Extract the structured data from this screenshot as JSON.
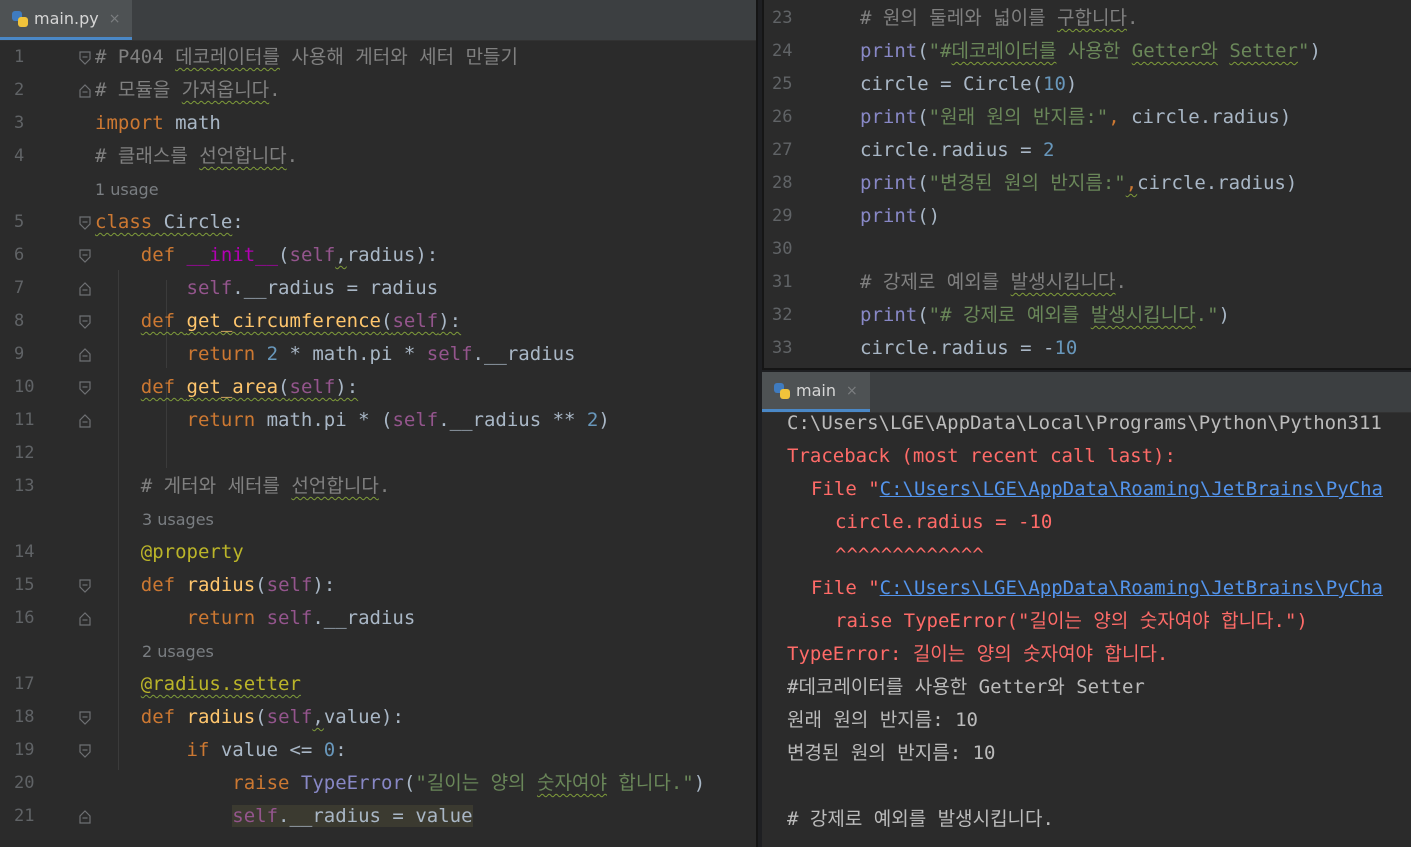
{
  "left_editor": {
    "tab": {
      "title": "main.py",
      "close": "×"
    },
    "lines": [
      {
        "num": "1",
        "parts": [
          [
            "cm",
            "# P404 "
          ],
          [
            "cm wv",
            "데코레이터를"
          ],
          [
            "cm",
            " 사용해 게터와 세터 만들기"
          ]
        ]
      },
      {
        "num": "2",
        "parts": [
          [
            "cm",
            "# 모듈을 "
          ],
          [
            "cm wv",
            "가져옵니다"
          ],
          [
            "cm",
            "."
          ]
        ]
      },
      {
        "num": "3",
        "parts": [
          [
            "kw",
            "import"
          ],
          [
            "",
            " math"
          ]
        ]
      },
      {
        "num": "4",
        "parts": [
          [
            "cm",
            "# 클래스를 "
          ],
          [
            "cm wv",
            "선언합니다"
          ],
          [
            "cm",
            "."
          ]
        ]
      },
      {
        "num": "5",
        "parts": [
          [
            "kw wv",
            "class"
          ],
          [
            "wv",
            " Circle"
          ],
          [
            "",
            ":"
          ]
        ]
      },
      {
        "num": "6",
        "parts": [
          [
            "",
            "    "
          ],
          [
            "kw",
            "def "
          ],
          [
            "mg",
            "__init__"
          ],
          [
            "",
            "("
          ],
          [
            "sf",
            "self"
          ],
          [
            "wv",
            ","
          ],
          [
            "",
            "radius):"
          ]
        ]
      },
      {
        "num": "7",
        "parts": [
          [
            "",
            "        "
          ],
          [
            "sf",
            "self"
          ],
          [
            "",
            ".__radius = radius"
          ]
        ]
      },
      {
        "num": "8",
        "parts": [
          [
            "",
            "    "
          ],
          [
            "kw wv",
            "def "
          ],
          [
            "fn wv",
            "get_circumference"
          ],
          [
            "wv",
            "("
          ],
          [
            "sf wv",
            "self"
          ],
          [
            "wv",
            "):"
          ]
        ]
      },
      {
        "num": "9",
        "parts": [
          [
            "",
            "        "
          ],
          [
            "kw",
            "return "
          ],
          [
            "nm",
            "2"
          ],
          [
            "",
            " * math.pi * "
          ],
          [
            "sf",
            "self"
          ],
          [
            "",
            ".__radius"
          ]
        ]
      },
      {
        "num": "10",
        "parts": [
          [
            "",
            "    "
          ],
          [
            "kw wv",
            "def "
          ],
          [
            "fn wv",
            "get_area"
          ],
          [
            "wv",
            "("
          ],
          [
            "sf wv",
            "self"
          ],
          [
            "wv",
            "):"
          ]
        ]
      },
      {
        "num": "11",
        "parts": [
          [
            "",
            "        "
          ],
          [
            "kw",
            "return"
          ],
          [
            "",
            " math.pi * ("
          ],
          [
            "sf",
            "self"
          ],
          [
            "",
            ".__radius ** "
          ],
          [
            "nm",
            "2"
          ],
          [
            "",
            ")"
          ]
        ]
      },
      {
        "num": "12",
        "parts": []
      },
      {
        "num": "13",
        "parts": [
          [
            "",
            "    "
          ],
          [
            "cm",
            "# 게터와 세터를 "
          ],
          [
            "cm wv",
            "선언합니다"
          ],
          [
            "cm",
            "."
          ]
        ]
      },
      {
        "num": "14",
        "parts": [
          [
            "",
            "    "
          ],
          [
            "dc",
            "@property"
          ]
        ]
      },
      {
        "num": "15",
        "parts": [
          [
            "",
            "    "
          ],
          [
            "kw",
            "def "
          ],
          [
            "fn",
            "radius"
          ],
          [
            "",
            "("
          ],
          [
            "sf",
            "self"
          ],
          [
            "",
            "):"
          ]
        ]
      },
      {
        "num": "16",
        "parts": [
          [
            "",
            "        "
          ],
          [
            "kw",
            "return "
          ],
          [
            "sf",
            "self"
          ],
          [
            "",
            ".__radius"
          ]
        ]
      },
      {
        "num": "17",
        "parts": [
          [
            "",
            "    "
          ],
          [
            "dc wv",
            "@radius.setter"
          ]
        ]
      },
      {
        "num": "18",
        "parts": [
          [
            "",
            "    "
          ],
          [
            "kw",
            "def "
          ],
          [
            "fn",
            "radius"
          ],
          [
            "",
            "("
          ],
          [
            "sf",
            "self"
          ],
          [
            "wv",
            ","
          ],
          [
            "",
            "value):"
          ]
        ]
      },
      {
        "num": "19",
        "parts": [
          [
            "",
            "        "
          ],
          [
            "kw",
            "if"
          ],
          [
            "",
            " value <= "
          ],
          [
            "nm",
            "0"
          ],
          [
            "",
            ":"
          ]
        ]
      },
      {
        "num": "20",
        "parts": [
          [
            "",
            "            "
          ],
          [
            "kw",
            "raise "
          ],
          [
            "bi",
            "TypeError"
          ],
          [
            "",
            "("
          ],
          [
            "st",
            "\"길이는 양의 "
          ],
          [
            "st wv",
            "숫자여야"
          ],
          [
            "st",
            " 합니다.\""
          ],
          [
            "",
            ")"
          ]
        ]
      },
      {
        "num": "21",
        "parts": [
          [
            "",
            "            "
          ],
          [
            "sf hl",
            "self"
          ],
          [
            "hl",
            ".__radius = value"
          ]
        ]
      }
    ],
    "usage_hints": [
      "1 usage",
      "3 usages",
      "2 usages"
    ]
  },
  "right_editor": {
    "lines": [
      {
        "num": "23",
        "parts": [
          [
            "cm",
            "# 원의 둘레와 넓이를 "
          ],
          [
            "cm wv",
            "구합니다"
          ],
          [
            "cm",
            "."
          ]
        ]
      },
      {
        "num": "24",
        "parts": [
          [
            "bi",
            "print"
          ],
          [
            "",
            "("
          ],
          [
            "st",
            "\"#"
          ],
          [
            "st wv",
            "데코레이터를"
          ],
          [
            "st",
            " 사용한 "
          ],
          [
            "st wv",
            "Getter와"
          ],
          [
            "st",
            " "
          ],
          [
            "st wv",
            "Setter"
          ],
          [
            "st",
            "\""
          ],
          [
            "",
            ")"
          ]
        ]
      },
      {
        "num": "25",
        "parts": [
          [
            "",
            "circle = Circle("
          ],
          [
            "nm",
            "10"
          ],
          [
            "",
            ")"
          ]
        ]
      },
      {
        "num": "26",
        "parts": [
          [
            "bi",
            "print"
          ],
          [
            "",
            "("
          ],
          [
            "st",
            "\"원래 원의 반지름:\""
          ],
          [
            "kw",
            ","
          ],
          [
            "",
            " circle.radius)"
          ]
        ]
      },
      {
        "num": "27",
        "parts": [
          [
            "",
            "circle.radius = "
          ],
          [
            "nm",
            "2"
          ]
        ]
      },
      {
        "num": "28",
        "parts": [
          [
            "bi",
            "print"
          ],
          [
            "",
            "("
          ],
          [
            "st",
            "\"변경된 원의 반지름:\""
          ],
          [
            "kw wv",
            ","
          ],
          [
            "",
            "circle.radius)"
          ]
        ]
      },
      {
        "num": "29",
        "parts": [
          [
            "bi",
            "print"
          ],
          [
            "",
            "()"
          ]
        ]
      },
      {
        "num": "30",
        "parts": []
      },
      {
        "num": "31",
        "parts": [
          [
            "cm",
            "# 강제로 예외를 "
          ],
          [
            "cm wv",
            "발생시킵니다"
          ],
          [
            "cm",
            "."
          ]
        ]
      },
      {
        "num": "32",
        "parts": [
          [
            "bi",
            "print"
          ],
          [
            "",
            "("
          ],
          [
            "st",
            "\"# 강제로 예외를 "
          ],
          [
            "st wv",
            "발생시킵니다"
          ],
          [
            "st",
            ".\""
          ],
          [
            "",
            ")"
          ]
        ]
      },
      {
        "num": "33",
        "parts": [
          [
            "",
            "circle.radius = -"
          ],
          [
            "nm",
            "10"
          ]
        ]
      }
    ]
  },
  "run_console": {
    "tab": {
      "title": "main",
      "close": "×"
    },
    "lines": [
      {
        "indent": 0,
        "parts": [
          [
            "",
            "C:\\Users\\LGE\\AppData\\Local\\Programs\\Python\\Python311"
          ]
        ]
      },
      {
        "indent": 0,
        "parts": [
          [
            "err",
            "Traceback (most recent call last):"
          ]
        ]
      },
      {
        "indent": 1,
        "parts": [
          [
            "err",
            "File \""
          ],
          [
            "link",
            "C:\\Users\\LGE\\AppData\\Roaming\\JetBrains\\PyCha"
          ]
        ]
      },
      {
        "indent": 2,
        "parts": [
          [
            "err",
            "circle.radius = -10"
          ]
        ]
      },
      {
        "indent": 2,
        "parts": [
          [
            "err",
            "^^^^^^^^^^^^^"
          ]
        ]
      },
      {
        "indent": 1,
        "parts": [
          [
            "err",
            "File \""
          ],
          [
            "link",
            "C:\\Users\\LGE\\AppData\\Roaming\\JetBrains\\PyCha"
          ]
        ]
      },
      {
        "indent": 2,
        "parts": [
          [
            "err",
            "raise TypeError(\"길이는 양의 숫자여야 합니다.\")"
          ]
        ]
      },
      {
        "indent": 0,
        "parts": [
          [
            "err",
            "TypeError: 길이는 양의 숫자여야 합니다."
          ]
        ]
      },
      {
        "indent": 0,
        "parts": [
          [
            "",
            "#데코레이터를 사용한 Getter와 Setter"
          ]
        ]
      },
      {
        "indent": 0,
        "parts": [
          [
            "",
            "원래 원의 반지름: 10"
          ]
        ]
      },
      {
        "indent": 0,
        "parts": [
          [
            "",
            "변경된 원의 반지름: 10"
          ]
        ]
      },
      {
        "indent": 0,
        "parts": []
      },
      {
        "indent": 0,
        "parts": [
          [
            "",
            "# 강제로 예외를 발생시킵니다."
          ]
        ]
      }
    ]
  },
  "colors": {
    "background": "#2b2b2b",
    "keyword": "#cc7832",
    "comment": "#808080",
    "string": "#6a8759",
    "number": "#6897bb",
    "self": "#94558d",
    "function": "#ffc66d",
    "error": "#ff6b68",
    "link": "#5394ec"
  }
}
